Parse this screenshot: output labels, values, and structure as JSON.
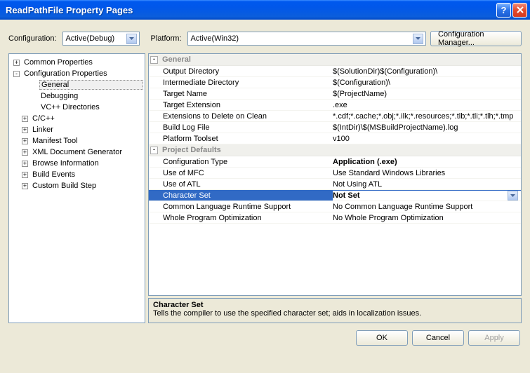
{
  "window": {
    "title": "ReadPathFile Property Pages"
  },
  "toolbar": {
    "config_label": "Configuration:",
    "config_value": "Active(Debug)",
    "platform_label": "Platform:",
    "platform_value": "Active(Win32)",
    "config_manager": "Configuration Manager..."
  },
  "tree": {
    "items": [
      {
        "label": "Common Properties",
        "expand": "+",
        "indent": 0
      },
      {
        "label": "Configuration Properties",
        "expand": "-",
        "indent": 0
      },
      {
        "label": "General",
        "expand": "",
        "indent": 2,
        "selected": true
      },
      {
        "label": "Debugging",
        "expand": "",
        "indent": 2
      },
      {
        "label": "VC++ Directories",
        "expand": "",
        "indent": 2
      },
      {
        "label": "C/C++",
        "expand": "+",
        "indent": 1
      },
      {
        "label": "Linker",
        "expand": "+",
        "indent": 1
      },
      {
        "label": "Manifest Tool",
        "expand": "+",
        "indent": 1
      },
      {
        "label": "XML Document Generator",
        "expand": "+",
        "indent": 1
      },
      {
        "label": "Browse Information",
        "expand": "+",
        "indent": 1
      },
      {
        "label": "Build Events",
        "expand": "+",
        "indent": 1
      },
      {
        "label": "Custom Build Step",
        "expand": "+",
        "indent": 1
      }
    ]
  },
  "grid": {
    "section1": "General",
    "rows1": [
      {
        "k": "Output Directory",
        "v": "$(SolutionDir)$(Configuration)\\"
      },
      {
        "k": "Intermediate Directory",
        "v": "$(Configuration)\\"
      },
      {
        "k": "Target Name",
        "v": "$(ProjectName)"
      },
      {
        "k": "Target Extension",
        "v": ".exe"
      },
      {
        "k": "Extensions to Delete on Clean",
        "v": "*.cdf;*.cache;*.obj;*.ilk;*.resources;*.tlb;*.tli;*.tlh;*.tmp"
      },
      {
        "k": "Build Log File",
        "v": "$(IntDir)\\$(MSBuildProjectName).log"
      },
      {
        "k": "Platform Toolset",
        "v": "v100"
      }
    ],
    "section2": "Project Defaults",
    "rows2": [
      {
        "k": "Configuration Type",
        "v": "Application (.exe)",
        "bold": true
      },
      {
        "k": "Use of MFC",
        "v": "Use Standard Windows Libraries"
      },
      {
        "k": "Use of ATL",
        "v": "Not Using ATL"
      },
      {
        "k": "Character Set",
        "v": "Not Set",
        "bold": true,
        "selected": true
      },
      {
        "k": "Common Language Runtime Support",
        "v": "No Common Language Runtime Support"
      },
      {
        "k": "Whole Program Optimization",
        "v": "No Whole Program Optimization"
      }
    ]
  },
  "desc": {
    "title": "Character Set",
    "text": "Tells the compiler to use the specified character set; aids in localization issues."
  },
  "buttons": {
    "ok": "OK",
    "cancel": "Cancel",
    "apply": "Apply"
  }
}
